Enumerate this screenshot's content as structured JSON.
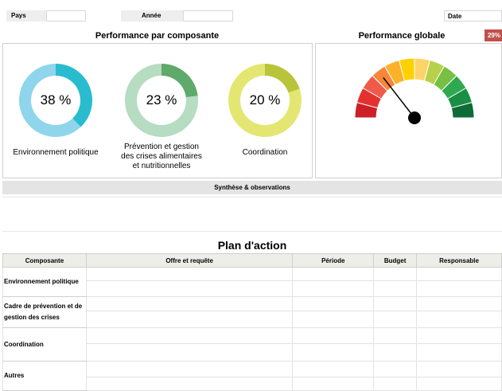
{
  "header": {
    "pays_label": "Pays",
    "annee_label": "Année",
    "date_label": "Date",
    "score_badge": "29%"
  },
  "performance_composante": {
    "title": "Performance par composante",
    "items": [
      {
        "percent_label": "38 %",
        "value": 0.38,
        "label_lines": [
          "Environnement politique"
        ],
        "color_fill": "#29bccf",
        "color_rest": "#8fd5ec"
      },
      {
        "percent_label": "23 %",
        "value": 0.23,
        "label_lines": [
          "Prévention et gestion",
          "des crises alimentaires",
          "et nutritionnelles"
        ],
        "color_fill": "#5fa96a",
        "color_rest": "#b6dcc1"
      },
      {
        "percent_label": "20 %",
        "value": 0.2,
        "label_lines": [
          "Coordination"
        ],
        "color_fill": "#b8c43a",
        "color_rest": "#e3e772"
      }
    ]
  },
  "performance_globale": {
    "title": "Performance globale",
    "value": 0.29,
    "gauge_colors": [
      "#cc1f27",
      "#e4312f",
      "#f05a4a",
      "#f7863a",
      "#fcb12b",
      "#fdd100",
      "#fdd46a",
      "#b8d14a",
      "#77c043",
      "#2fa84f",
      "#1a8e45",
      "#0d6b37"
    ]
  },
  "synthese": {
    "title": "Synthèse & observations"
  },
  "plan": {
    "title": "Plan d'action",
    "headers": [
      "Composante",
      "Offre et requête",
      "Période",
      "Budget",
      "Responsable"
    ],
    "rows": [
      {
        "lines": [
          "Environnement politique"
        ]
      },
      {
        "lines": [
          "Cadre de prévention et de",
          "gestion des crises"
        ]
      },
      {
        "lines": [
          "Coordination"
        ]
      },
      {
        "lines": [
          "Autres"
        ]
      }
    ]
  }
}
